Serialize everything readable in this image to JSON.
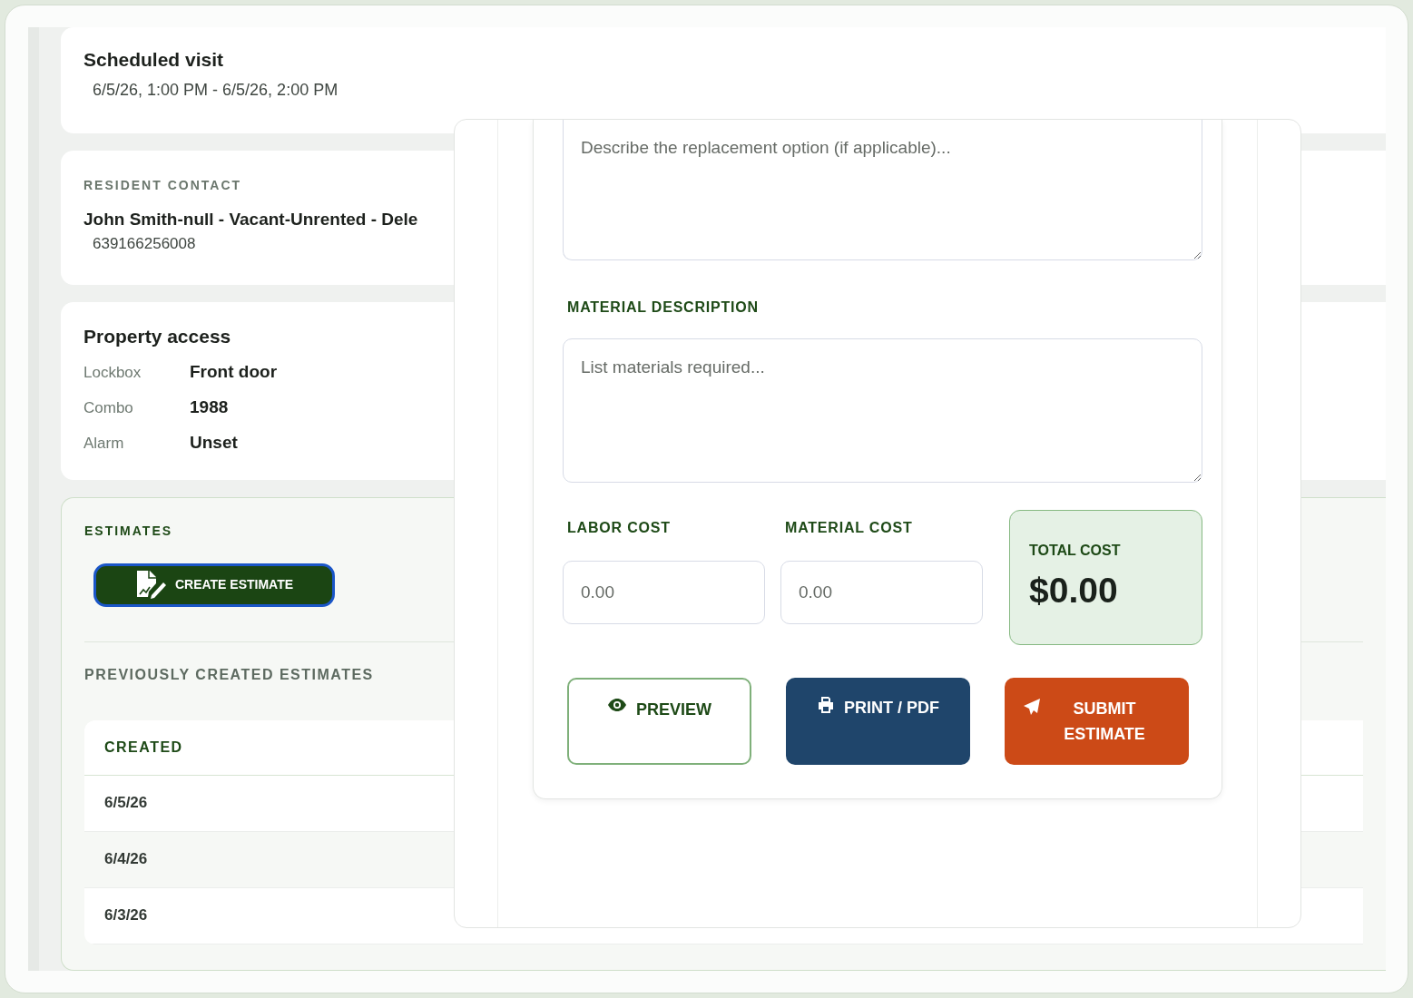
{
  "scheduled_visit": {
    "title": "Scheduled visit",
    "time": "6/5/26, 1:00 PM - 6/5/26, 2:00 PM"
  },
  "resident_contact": {
    "label": "RESIDENT CONTACT",
    "name": "John Smith-null - Vacant-Unrented - Dele",
    "phone": "639166256008"
  },
  "property_access": {
    "title": "Property access",
    "rows": [
      {
        "label": "Lockbox",
        "value": "Front door"
      },
      {
        "label": "Combo",
        "value": "1988"
      },
      {
        "label": "Alarm",
        "value": "Unset"
      }
    ]
  },
  "estimates": {
    "label": "ESTIMATES",
    "create_button": "CREATE ESTIMATE",
    "previous_label": "PREVIOUSLY CREATED ESTIMATES",
    "table": {
      "columns": [
        "CREATED"
      ],
      "rows": [
        [
          "6/5/26"
        ],
        [
          "6/4/26"
        ],
        [
          "6/3/26"
        ]
      ]
    }
  },
  "estimate_form": {
    "replacement": {
      "placeholder": "Describe the replacement option (if applicable)..."
    },
    "material_description": {
      "label": "MATERIAL DESCRIPTION",
      "placeholder": "List materials required..."
    },
    "labor_cost": {
      "label": "LABOR COST",
      "placeholder": "0.00"
    },
    "material_cost": {
      "label": "MATERIAL COST",
      "placeholder": "0.00"
    },
    "total_cost": {
      "label": "TOTAL COST",
      "value": "$0.00"
    },
    "buttons": [
      {
        "label": "PREVIEW",
        "kind": "preview"
      },
      {
        "label": "PRINT / PDF",
        "kind": "print"
      },
      {
        "label": "SUBMIT ESTIMATE",
        "kind": "submit"
      }
    ]
  }
}
